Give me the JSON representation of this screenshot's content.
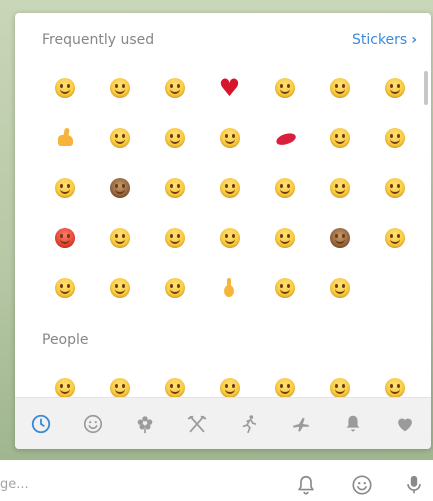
{
  "panel": {
    "sections": [
      {
        "title": "Frequently used",
        "action": {
          "label": "Stickers",
          "chevron": "›"
        },
        "emojis": [
          "smiling-face",
          "joy-face",
          "kiss-face",
          "red-heart",
          "heart-eyes-face",
          "blush-face",
          "grin-face",
          "thumbs-up",
          "relieved-face",
          "grin-face",
          "crying-face",
          "kiss-lips",
          "unamused-face",
          "flushed-face",
          "tongue-face",
          "see-no-evil-monkey",
          "wink-face",
          "smiley-face",
          "sad-face",
          "squint-tongue-face",
          "scream-face",
          "angry-face",
          "smirk-face",
          "disappointed-face",
          "sweat-smile-face",
          "kissing-face",
          "monkey-face",
          "relieved-face",
          "grin-face",
          "yum-face",
          "laughing-face",
          "ok-hand",
          "neutral-face",
          "confused-face"
        ]
      },
      {
        "title": "People",
        "emojis": [
          "grin-face",
          "grin-face",
          "grin-face",
          "joy-face",
          "smiley-face",
          "grin-face",
          "sweat-smile-face"
        ]
      }
    ],
    "tabs": [
      {
        "name": "recent-tab",
        "icon": "clock-icon",
        "active": true
      },
      {
        "name": "people-tab",
        "icon": "smile-icon"
      },
      {
        "name": "nature-tab",
        "icon": "flower-icon"
      },
      {
        "name": "food-tab",
        "icon": "fork-knife-icon"
      },
      {
        "name": "activity-tab",
        "icon": "runner-icon"
      },
      {
        "name": "travel-tab",
        "icon": "plane-icon"
      },
      {
        "name": "objects-tab",
        "icon": "bell-icon"
      },
      {
        "name": "symbols-tab",
        "icon": "heart-icon"
      }
    ],
    "accent_color": "#3b8bd8",
    "icon_color": "#9b9b9b"
  },
  "composer": {
    "placeholder": "ge..."
  }
}
